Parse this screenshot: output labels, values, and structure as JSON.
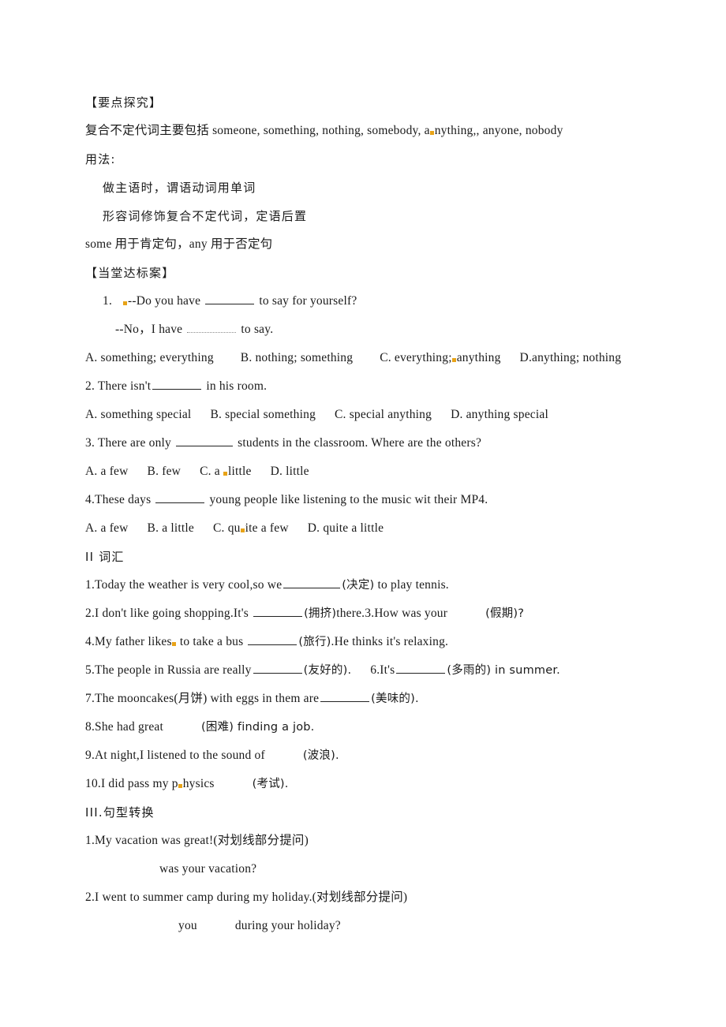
{
  "document": {
    "type": "worksheet",
    "language": "zh-CN/en",
    "sections": [
      {
        "id": "key-points",
        "heading": "【要点探究】",
        "lines": [
          "复合不定代词主要包括 someone, something, nothing, somebody, a",
          "用法:",
          "做主语时，谓语动词用单词",
          "形容词修饰复合不定代词，定语后置",
          "some 用于肯定句，any 用于否定句"
        ]
      }
    ]
  },
  "headings": {
    "key_points": "【要点探究】",
    "in_class_test": "【当堂达标案】",
    "section_ii": "II 词汇",
    "section_iii": "III.句型转换"
  },
  "key_points": {
    "compound_intro_pre": "复合不定代词主要包括 someone, something, nothing, somebody, a",
    "compound_intro_post": "nything,, anyone, nobody",
    "usage_label": "用法:",
    "rule_1": "做主语时，谓语动词用单词",
    "rule_2": "形容词修饰复合不定代词，定语后置",
    "rule_3": "some 用于肯定句，any 用于否定句"
  },
  "choice_questions": [
    {
      "number": "1.",
      "stem_pre": "--Do you have",
      "stem_post": "to say for yourself?",
      "stem_line2_pre": "--No，I have",
      "stem_line2_post": "to say.",
      "options": [
        "A. something; everything",
        "B. nothing; something",
        "C. everything;",
        "anything",
        "D.anything; nothing"
      ]
    },
    {
      "number": "2.",
      "stem_pre": "There isn't",
      "stem_post": "in his room.",
      "options": [
        "A. something special",
        "B. special something",
        "C. special anything",
        "D. anything special"
      ]
    },
    {
      "number": "3.",
      "stem_pre": "There are only",
      "stem_post": "students in the classroom. Where are the others?",
      "options": [
        "A. a few",
        "B. few",
        "C. a",
        "little",
        "D. little"
      ]
    },
    {
      "number": "4.",
      "stem_pre": "These days",
      "stem_post": "young people like listening to the music wit their MP4.",
      "options": [
        "A. a few",
        "B. a little",
        "C. qu",
        "ite a few",
        "D. quite a little"
      ]
    }
  ],
  "vocabulary": {
    "title": "II 词汇",
    "items": [
      {
        "number": "1.",
        "pre": "Today the weather is very cool,so we",
        "hint": "(决定)",
        "post": "to play tennis."
      },
      {
        "number": "2.",
        "pre": "I don't like going shopping.It's",
        "hint": "(拥挤)",
        "post": "there.3.How was your",
        "hint2": "(假期)?"
      },
      {
        "number": "4.",
        "pre": "My father likes",
        "pre2": "to take a bus",
        "hint": "(旅行)",
        "post": ".He thinks it's relaxing."
      },
      {
        "number": "5.",
        "pre": "The people in Russia are really",
        "hint": "(友好的).",
        "post": "6.It's",
        "hint2": "(多雨的) in summer."
      },
      {
        "number": "7.",
        "pre": "The mooncakes(月饼) with eggs in them are",
        "hint": "(美味的).",
        "post": ""
      },
      {
        "number": "8.",
        "pre": "She had great",
        "hint": "(困难) finding a job.",
        "post": ""
      },
      {
        "number": "9.",
        "pre": "At night,I listened to the sound of",
        "hint": "(波浪).",
        "post": ""
      },
      {
        "number": "10.",
        "pre": "I did pass my p",
        "pre2": "hysics",
        "hint": "(考试).",
        "post": ""
      }
    ]
  },
  "transformation": {
    "title": "III.句型转换",
    "items": [
      {
        "number": "1.",
        "sentence": "My vacation was great!(对划线部分提问)",
        "answer_line": "was your vacation?"
      },
      {
        "number": "2.",
        "sentence": "I went to summer camp during my holiday.(对划线部分提问)",
        "answer_pre": "you",
        "answer_post": "during your holiday?"
      }
    ]
  },
  "colors": {
    "text": "#1a1a1a",
    "background": "#ffffff",
    "proofing_mark": "#e8a317",
    "blank_rule": "#222222",
    "dotted_rule": "#8a8a8a"
  }
}
